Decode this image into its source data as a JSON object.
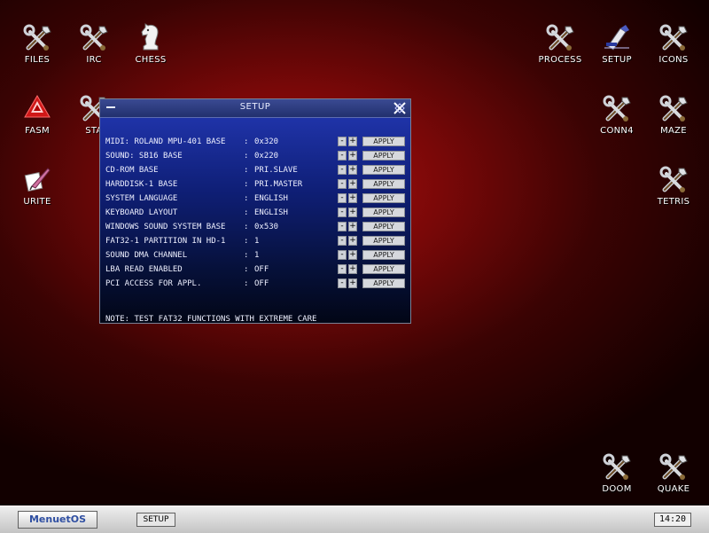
{
  "desktop": {
    "icons": [
      {
        "id": "files",
        "label": "FILES",
        "icon": "tools-icon"
      },
      {
        "id": "irc",
        "label": "IRC",
        "icon": "tools-icon"
      },
      {
        "id": "chess",
        "label": "CHESS",
        "icon": "chess-knight-icon"
      },
      {
        "id": "fasm",
        "label": "FASM",
        "icon": "fasm-icon"
      },
      {
        "id": "sta",
        "label": "STA",
        "icon": "tools-icon"
      },
      {
        "id": "write",
        "label": "URITE",
        "icon": "quill-icon"
      },
      {
        "id": "process",
        "label": "PROCESS",
        "icon": "tools-icon"
      },
      {
        "id": "setup",
        "label": "SETUP",
        "icon": "setup-icon"
      },
      {
        "id": "icons",
        "label": "ICONS",
        "icon": "tools-icon"
      },
      {
        "id": "conn4",
        "label": "CONN4",
        "icon": "tools-icon"
      },
      {
        "id": "maze",
        "label": "MAZE",
        "icon": "tools-icon"
      },
      {
        "id": "tetris",
        "label": "TETRIS",
        "icon": "tools-icon"
      },
      {
        "id": "doom",
        "label": "DOOM",
        "icon": "tools-icon"
      },
      {
        "id": "quake",
        "label": "QUAKE",
        "icon": "tools-icon"
      }
    ]
  },
  "window": {
    "title": "SETUP",
    "apply_label": "APPLY",
    "minus_label": "-",
    "plus_label": "+",
    "separator": ":",
    "settings": [
      {
        "label": "MIDI: ROLAND MPU-401 BASE",
        "value": "0x320"
      },
      {
        "label": "SOUND: SB16 BASE",
        "value": "0x220"
      },
      {
        "label": "CD-ROM BASE",
        "value": "PRI.SLAVE"
      },
      {
        "label": "HARDDISK-1 BASE",
        "value": "PRI.MASTER"
      },
      {
        "label": "SYSTEM LANGUAGE",
        "value": "ENGLISH"
      },
      {
        "label": "KEYBOARD LAYOUT",
        "value": "ENGLISH"
      },
      {
        "label": "WINDOWS SOUND SYSTEM BASE",
        "value": "0x530"
      },
      {
        "label": "FAT32-1 PARTITION IN HD-1",
        "value": "1"
      },
      {
        "label": "SOUND DMA CHANNEL",
        "value": "1"
      },
      {
        "label": "LBA READ ENABLED",
        "value": "OFF"
      },
      {
        "label": "PCI ACCESS FOR APPL.",
        "value": "OFF"
      }
    ],
    "note": "NOTE: TEST FAT32 FUNCTIONS WITH EXTREME CARE"
  },
  "taskbar": {
    "start_label": "MenuetOS",
    "tasks": [
      "SETUP"
    ],
    "clock": "14:20"
  }
}
